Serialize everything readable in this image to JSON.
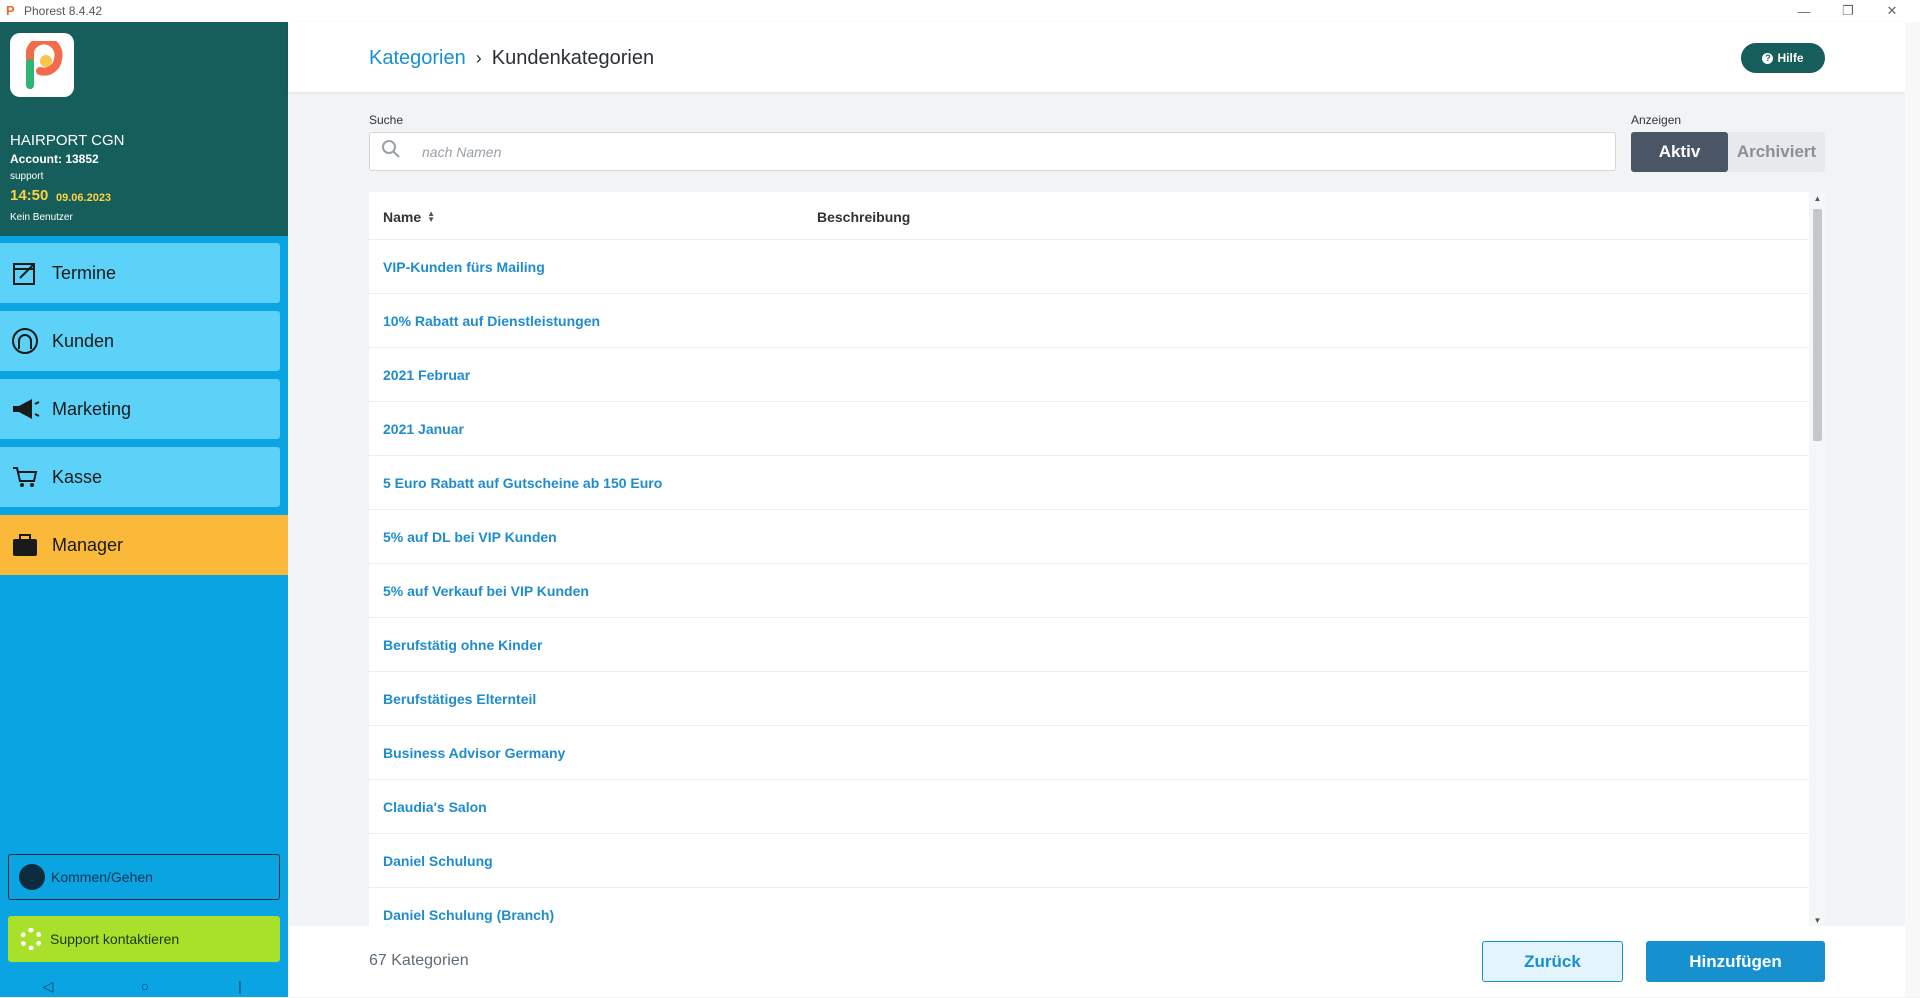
{
  "window": {
    "title": "Phorest 8.4.42",
    "minimize": "—",
    "restore": "❐",
    "close": "✕"
  },
  "sidebar": {
    "salon": "HAIRPORT CGN",
    "account": "Account: 13852",
    "user": "support",
    "time": "14:50",
    "date": "09.06.2023",
    "no_user": "Kein Benutzer",
    "nav": [
      {
        "label": "Termine",
        "icon": "calendar-icon"
      },
      {
        "label": "Kunden",
        "icon": "client-icon"
      },
      {
        "label": "Marketing",
        "icon": "megaphone-icon"
      },
      {
        "label": "Kasse",
        "icon": "cart-icon"
      },
      {
        "label": "Manager",
        "icon": "briefcase-icon"
      }
    ],
    "clock_in": "Kommen/Gehen",
    "support": "Support kontaktieren"
  },
  "header": {
    "breadcrumb_parent": "Kategorien",
    "breadcrumb_current": "Kundenkategorien",
    "help": "Hilfe"
  },
  "search": {
    "label": "Suche",
    "placeholder": "nach Namen",
    "value": ""
  },
  "filter": {
    "label": "Anzeigen",
    "options": [
      "Aktiv",
      "Archiviert"
    ],
    "selected": "Aktiv"
  },
  "table": {
    "columns": [
      "Name",
      "Beschreibung"
    ],
    "rows": [
      "VIP-Kunden fürs Mailing",
      "10% Rabatt auf Dienstleistungen",
      "2021 Februar",
      "2021 Januar",
      "5 Euro Rabatt auf Gutscheine ab 150 Euro",
      "5% auf DL bei VIP Kunden",
      "5% auf Verkauf bei VIP Kunden",
      "Berufstätig ohne Kinder",
      "Berufstätiges Elternteil",
      "Business Advisor Germany",
      "Claudia's Salon",
      "Daniel Schulung",
      "Daniel Schulung (Branch)"
    ]
  },
  "footer": {
    "count": "67 Kategorien",
    "back": "Zurück",
    "add": "Hinzufügen"
  },
  "colors": {
    "sidebar": "#0aa4e2",
    "sidebar_head": "#155e5b",
    "nav_item": "#5cd2f9",
    "nav_active": "#fbb93a",
    "accent": "#1690cf",
    "support": "#a8e02a"
  }
}
